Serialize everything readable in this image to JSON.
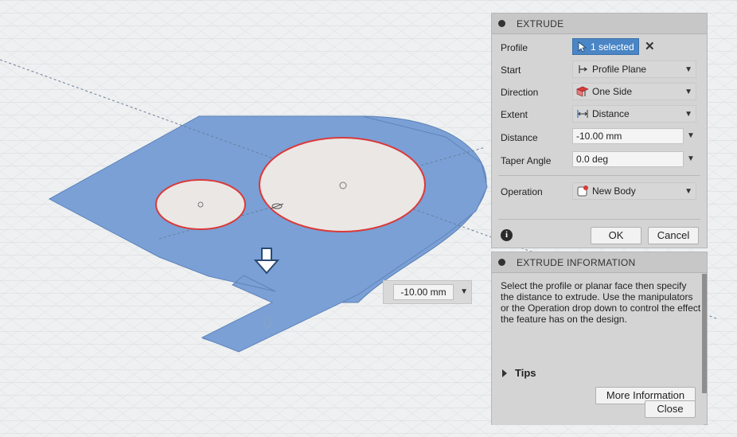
{
  "viewport": {
    "distance_manipulator": "-10.00 mm"
  },
  "extrude_panel": {
    "title": "EXTRUDE",
    "profile": {
      "label": "Profile",
      "value": "1 selected"
    },
    "start": {
      "label": "Start",
      "value": "Profile Plane"
    },
    "direction": {
      "label": "Direction",
      "value": "One Side"
    },
    "extent": {
      "label": "Extent",
      "value": "Distance"
    },
    "distance": {
      "label": "Distance",
      "value": "-10.00 mm"
    },
    "taper_angle": {
      "label": "Taper Angle",
      "value": "0.0 deg"
    },
    "operation": {
      "label": "Operation",
      "value": "New Body"
    },
    "ok_label": "OK",
    "cancel_label": "Cancel"
  },
  "info_panel": {
    "title": "EXTRUDE INFORMATION",
    "text": "Select the profile or planar face then specify the distance to extrude. Use the manipulators or the Operation drop down to control the effect the feature has on the design.",
    "tips_label": "Tips",
    "more_info_label": "More Information",
    "close_label": "Close"
  },
  "colors": {
    "profile_fill": "#7aa0d6",
    "selection_outline": "#d93a3a",
    "accent": "#4a86c5"
  }
}
